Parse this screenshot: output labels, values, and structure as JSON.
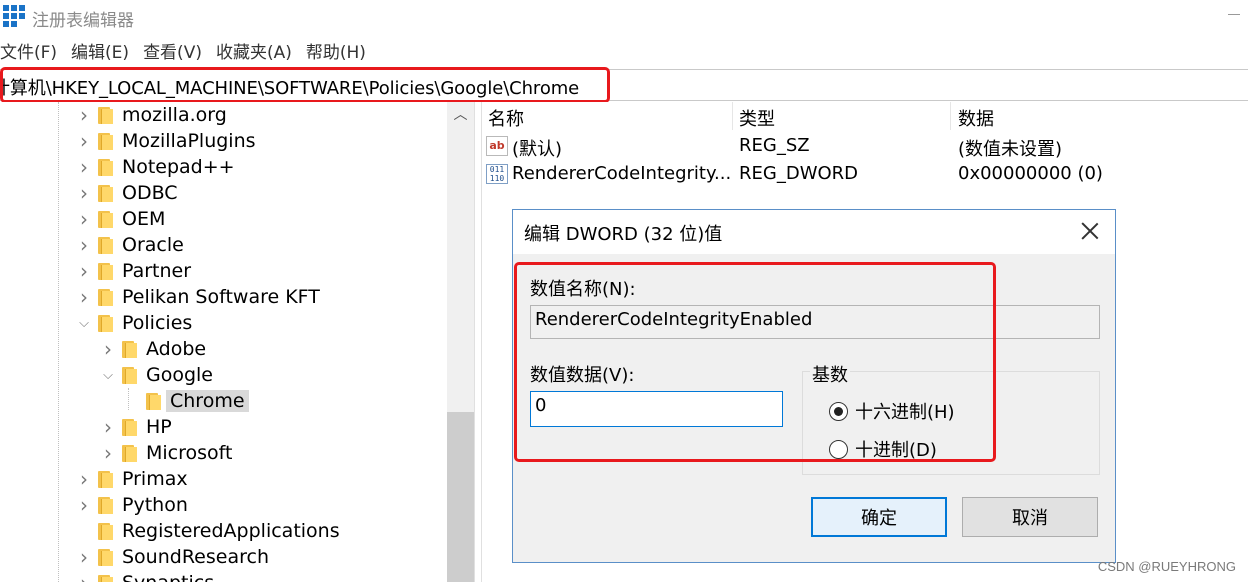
{
  "window": {
    "title": "注册表编辑器"
  },
  "menu": [
    "文件(F)",
    "编辑(E)",
    "查看(V)",
    "收藏夹(A)",
    "帮助(H)"
  ],
  "address": "计算机\\HKEY_LOCAL_MACHINE\\SOFTWARE\\Policies\\Google\\Chrome",
  "tree": [
    {
      "label": "mozilla.org",
      "expanded": false
    },
    {
      "label": "MozillaPlugins",
      "expanded": false
    },
    {
      "label": "Notepad++",
      "expanded": false
    },
    {
      "label": "ODBC",
      "expanded": false
    },
    {
      "label": "OEM",
      "expanded": false
    },
    {
      "label": "Oracle",
      "expanded": false
    },
    {
      "label": "Partner",
      "expanded": false
    },
    {
      "label": "Pelikan Software KFT",
      "expanded": false
    },
    {
      "label": "Policies",
      "expanded": true
    },
    {
      "label": "Adobe",
      "expanded": false
    },
    {
      "label": "Google",
      "expanded": true
    },
    {
      "label": "Chrome",
      "selected": true
    },
    {
      "label": "HP",
      "expanded": false
    },
    {
      "label": "Microsoft",
      "expanded": false
    },
    {
      "label": "Primax",
      "expanded": false
    },
    {
      "label": "Python",
      "expanded": false
    },
    {
      "label": "RegisteredApplications"
    },
    {
      "label": "SoundResearch",
      "expanded": false
    },
    {
      "label": "Synaptics",
      "expanded": false
    }
  ],
  "list": {
    "columns": [
      "名称",
      "类型",
      "数据"
    ],
    "rows": [
      {
        "icon": "string-value-icon",
        "icon_text": "ab",
        "name": "(默认)",
        "type": "REG_SZ",
        "data": "(数值未设置)"
      },
      {
        "icon": "binary-value-icon",
        "icon_text": "011 110",
        "name": "RendererCodeIntegrity...",
        "type": "REG_DWORD",
        "data": "0x00000000 (0)"
      }
    ]
  },
  "dialog": {
    "title": "编辑 DWORD (32 位)值",
    "name_label": "数值名称(N):",
    "name_value": "RendererCodeIntegrityEnabled",
    "data_label": "数值数据(V):",
    "data_value": "0",
    "base_label": "基数",
    "radio_hex": "十六进制(H)",
    "radio_dec": "十进制(D)",
    "selected_base": "hex",
    "ok": "确定",
    "cancel": "取消"
  },
  "watermark": "CSDN @RUEYHRONG",
  "colors": {
    "annotation_red": "#e8191d",
    "accent_blue": "#0078d7",
    "folder_yellow": "#ffd86a"
  }
}
